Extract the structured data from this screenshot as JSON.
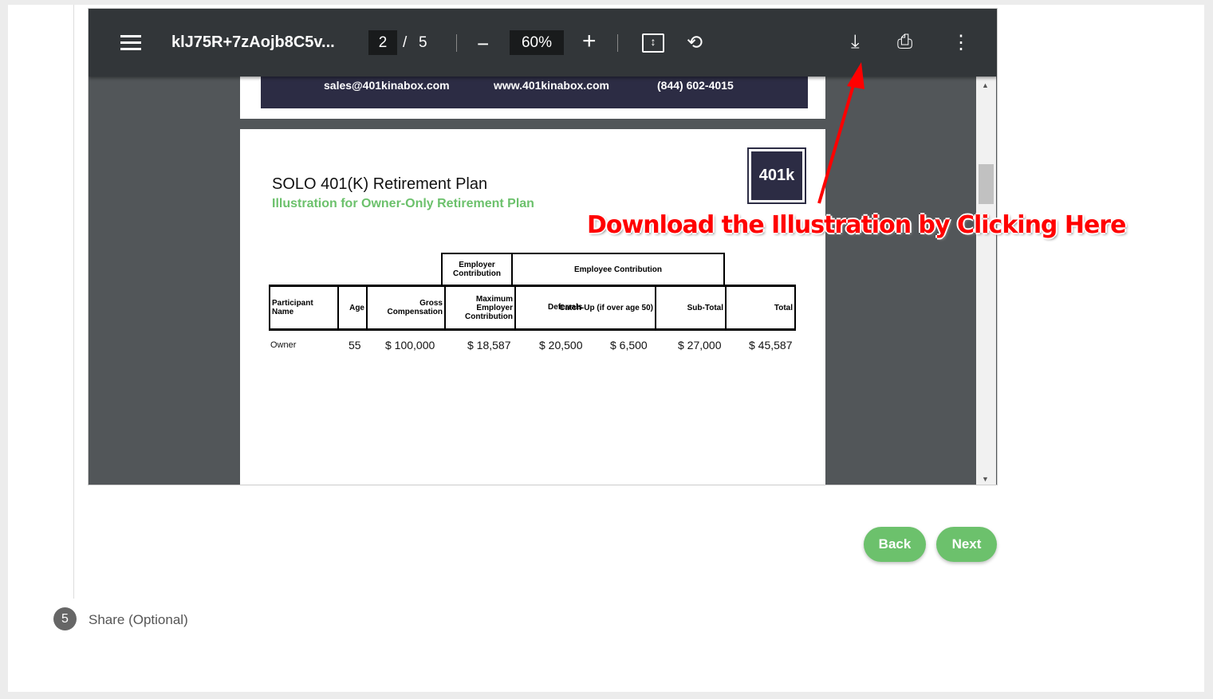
{
  "viewer": {
    "filename": "klJ75R+7zAojb8C5v...",
    "page": "2",
    "page_sep": "/",
    "total_pages": "5",
    "zoom": "60%",
    "zoom_out": "−",
    "zoom_in": "+"
  },
  "page1": {
    "email": "sales@401kinabox.com",
    "website": "www.401kinabox.com",
    "phone": "(844) 602-4015"
  },
  "page2": {
    "title": "SOLO 401(K) Retirement Plan",
    "subtitle": "Illustration for Owner-Only Retirement Plan",
    "logo": "401k",
    "group_headers": [
      "Employer Contribution",
      "Employee Contribution"
    ],
    "columns": [
      "Participant Name",
      "Age",
      "Gross Compensation",
      "Maximum Employer Contribution",
      "Deferrals",
      "Catch-Up (if over age 50)",
      "Sub-Total",
      "Total"
    ],
    "row": [
      "Owner",
      "55",
      "$ 100,000",
      "$ 18,587",
      "$ 20,500",
      "$ 6,500",
      "$ 27,000",
      "$ 45,587"
    ]
  },
  "annotation": "Download the Illustration by Clicking Here",
  "buttons": {
    "back": "Back",
    "next": "Next"
  },
  "step": {
    "number": "5",
    "label": "Share (Optional)"
  },
  "colors": {
    "accent": "#6cc16c",
    "toolbar": "#323639",
    "annotation": "#ff0000"
  }
}
